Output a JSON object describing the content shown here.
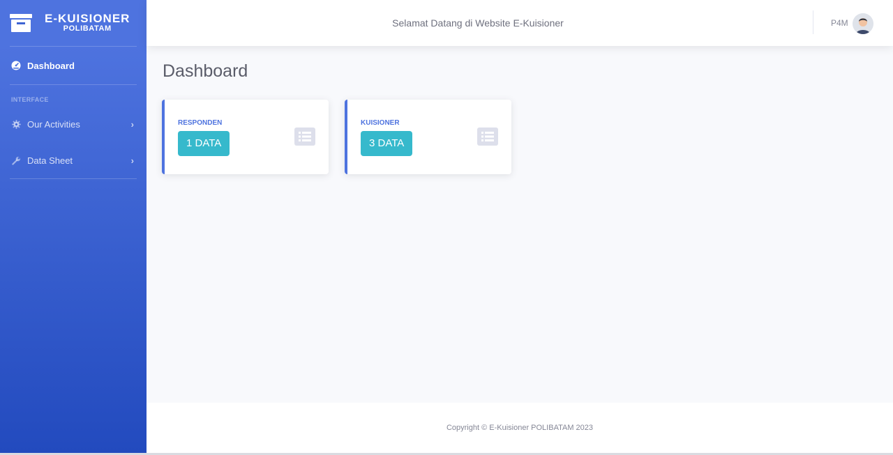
{
  "brand": {
    "title": "E-KUISIONER",
    "subtitle": "POLIBATAM",
    "icon": "archive-icon"
  },
  "sidebar": {
    "dashboard": {
      "label": "Dashboard",
      "icon": "tachometer-icon"
    },
    "heading": "INTERFACE",
    "items": [
      {
        "label": "Our Activities",
        "icon": "cog-icon"
      },
      {
        "label": "Data Sheet",
        "icon": "wrench-icon"
      }
    ]
  },
  "topbar": {
    "welcome": "Selamat Datang di Website E-Kuisioner",
    "user": "P4M"
  },
  "main": {
    "title": "Dashboard",
    "cards": [
      {
        "label": "RESPONDEN",
        "value": "1 DATA",
        "icon": "list-icon"
      },
      {
        "label": "KUISIONER",
        "value": "3 DATA",
        "icon": "list-icon"
      }
    ]
  },
  "footer": {
    "copyright": "Copyright © E-Kuisioner POLIBATAM 2023"
  },
  "colors": {
    "primary": "#4e73df",
    "info": "#36b9cc"
  }
}
